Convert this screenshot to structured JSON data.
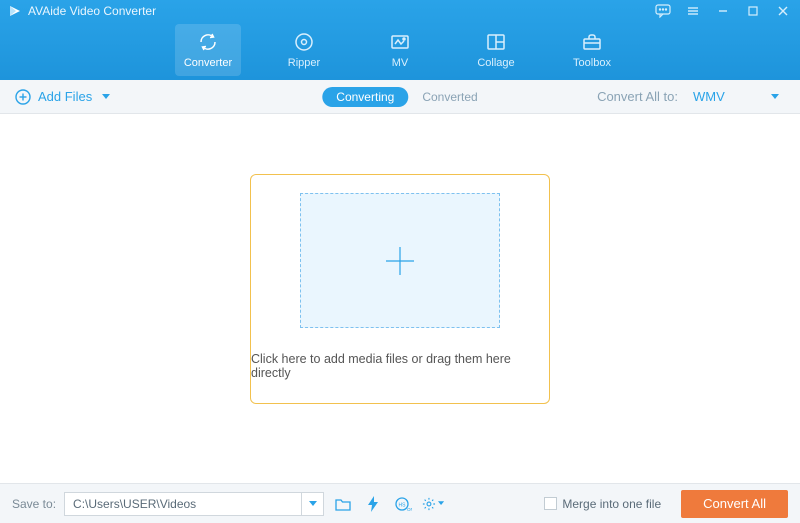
{
  "app": {
    "title": "AVAide Video Converter"
  },
  "tabs": {
    "converter": "Converter",
    "ripper": "Ripper",
    "mv": "MV",
    "collage": "Collage",
    "toolbox": "Toolbox"
  },
  "subbar": {
    "addFiles": "Add Files",
    "converting": "Converting",
    "converted": "Converted",
    "convertAllTo": "Convert All to:",
    "format": "WMV"
  },
  "dropzone": {
    "text": "Click here to add media files or drag them here directly"
  },
  "footer": {
    "saveTo": "Save to:",
    "path": "C:\\Users\\USER\\Videos",
    "merge": "Merge into one file",
    "convertAll": "Convert All"
  },
  "colors": {
    "primary": "#2aa3e8",
    "accent": "#ef7a3c",
    "highlight": "#f2c14e"
  }
}
